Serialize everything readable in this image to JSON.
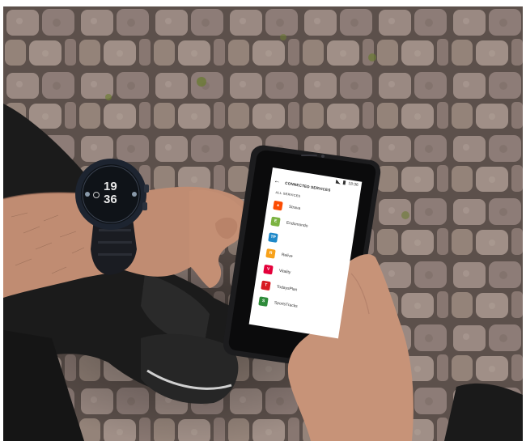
{
  "scene": {
    "description_tags": [
      "cobblestone-ground",
      "runner-arm",
      "smartwatch",
      "smartphone",
      "hand"
    ]
  },
  "watch": {
    "hours": "19",
    "minutes": "36"
  },
  "phone": {
    "status_time": "18:36",
    "header_title": "CONNECTED SERVICES",
    "section_title": "ALL SERVICES",
    "services": [
      {
        "label": "Strava",
        "icon": "strava-icon",
        "color": "#fc4c02",
        "glyph": "▲"
      },
      {
        "label": "Endomondo",
        "icon": "endomondo-icon",
        "color": "#7cb342",
        "glyph": "E"
      },
      {
        "label": "",
        "icon": "trainingpeaks-icon",
        "color": "#1e88c8",
        "glyph": "TP"
      },
      {
        "label": "Relive",
        "icon": "relive-icon",
        "color": "#f7a11a",
        "glyph": "R"
      },
      {
        "label": "Vitality",
        "icon": "vitality-icon",
        "color": "#e4003a",
        "glyph": "V"
      },
      {
        "label": "TodaysPlan",
        "icon": "todaysplan-icon",
        "color": "#d71920",
        "glyph": "T"
      },
      {
        "label": "SportsTracks",
        "icon": "sportstracks-icon",
        "color": "#2e8b3a",
        "glyph": "S"
      }
    ]
  },
  "colors": {
    "cobble": "#8e7e78",
    "grout": "#5a4f4a",
    "skin": "#c9957a",
    "phone_body": "#1c1c1e",
    "watch_body": "#1d2430"
  }
}
